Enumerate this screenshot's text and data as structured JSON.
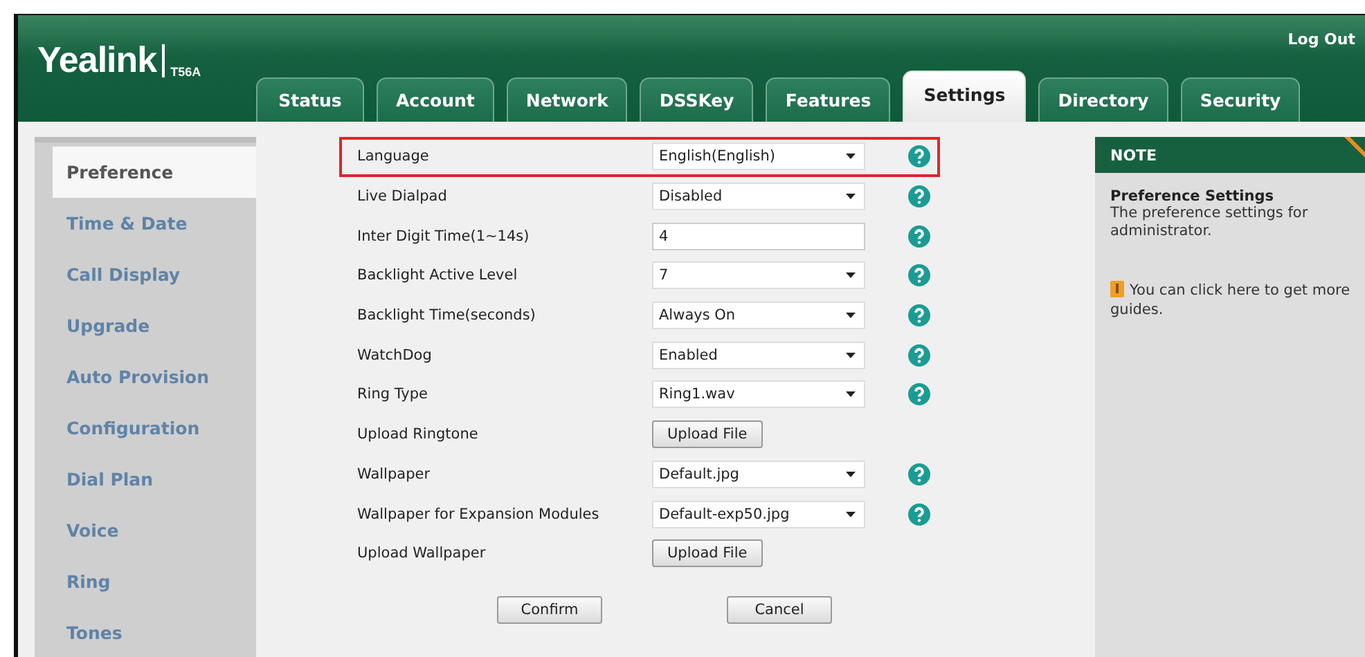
{
  "header": {
    "logo": "Yealink",
    "model": "T56A",
    "logout": "Log Out"
  },
  "tabs": [
    {
      "label": "Status",
      "selected": false
    },
    {
      "label": "Account",
      "selected": false
    },
    {
      "label": "Network",
      "selected": false
    },
    {
      "label": "DSSKey",
      "selected": false
    },
    {
      "label": "Features",
      "selected": false
    },
    {
      "label": "Settings",
      "selected": true
    },
    {
      "label": "Directory",
      "selected": false
    },
    {
      "label": "Security",
      "selected": false
    }
  ],
  "sidebar": {
    "items": [
      {
        "label": "Preference",
        "selected": true
      },
      {
        "label": "Time & Date",
        "selected": false
      },
      {
        "label": "Call Display",
        "selected": false
      },
      {
        "label": "Upgrade",
        "selected": false
      },
      {
        "label": "Auto Provision",
        "selected": false
      },
      {
        "label": "Configuration",
        "selected": false
      },
      {
        "label": "Dial Plan",
        "selected": false
      },
      {
        "label": "Voice",
        "selected": false
      },
      {
        "label": "Ring",
        "selected": false
      },
      {
        "label": "Tones",
        "selected": false
      }
    ]
  },
  "form": {
    "rows": [
      {
        "label": "Language",
        "kind": "select",
        "value": "English(English)",
        "highlighted": true
      },
      {
        "label": "Live Dialpad",
        "kind": "select",
        "value": "Disabled",
        "highlighted": false
      },
      {
        "label": "Inter Digit Time(1~14s)",
        "kind": "input",
        "value": "4",
        "highlighted": false
      },
      {
        "label": "Backlight Active Level",
        "kind": "select",
        "value": "7",
        "highlighted": false
      },
      {
        "label": "Backlight Time(seconds)",
        "kind": "select",
        "value": "Always On",
        "highlighted": false
      },
      {
        "label": "WatchDog",
        "kind": "select",
        "value": "Enabled",
        "highlighted": false
      },
      {
        "label": "Ring Type",
        "kind": "select",
        "value": "Ring1.wav",
        "highlighted": false
      },
      {
        "label": "Upload Ringtone",
        "kind": "button",
        "value": "Upload File",
        "highlighted": false
      },
      {
        "label": "Wallpaper",
        "kind": "select",
        "value": "Default.jpg",
        "highlighted": false
      },
      {
        "label": "Wallpaper for Expansion Modules",
        "kind": "select",
        "value": "Default-exp50.jpg",
        "highlighted": false
      },
      {
        "label": "Upload Wallpaper",
        "kind": "button",
        "value": "Upload File",
        "highlighted": false
      }
    ],
    "buttons": [
      "Confirm",
      "Cancel"
    ]
  },
  "note": {
    "title": "NOTE",
    "heading": "Preference Settings",
    "text": "The preference settings for administrator.",
    "guide": "You can click here to get more guides."
  }
}
